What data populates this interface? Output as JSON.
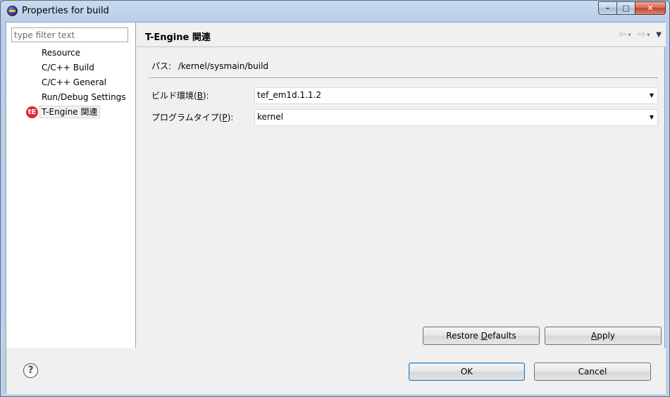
{
  "window": {
    "title": "Properties for build",
    "controls": {
      "minimize": "–",
      "maximize": "□",
      "close": "✕"
    }
  },
  "sidebar": {
    "filter_placeholder": "type filter text",
    "items": [
      {
        "label": "Resource"
      },
      {
        "label": "C/C++ Build"
      },
      {
        "label": "C/C++ General"
      },
      {
        "label": "Run/Debug Settings"
      },
      {
        "label": "T-Engine 関連",
        "icon": "t-engine-icon",
        "icon_text": "tE",
        "selected": true
      }
    ]
  },
  "page": {
    "title": "T-Engine 関連",
    "nav": {
      "back": "⇦",
      "forward": "⇨",
      "dropdown": "▾",
      "menu": "▼"
    },
    "path_label": "パス:",
    "path_value": "/kernel/sysmain/build",
    "build_env": {
      "label_prefix": "ビルド環境(",
      "mnemonic": "B",
      "label_suffix": "):",
      "value": "tef_em1d.1.1.2"
    },
    "program_type": {
      "label_prefix": "プログラムタイプ(",
      "mnemonic": "P",
      "label_suffix": "):",
      "value": "kernel"
    },
    "dropdown_arrow": "▼",
    "restore_defaults": {
      "prefix": "Restore ",
      "mnemonic": "D",
      "suffix": "efaults"
    },
    "apply": {
      "prefix": "",
      "mnemonic": "A",
      "suffix": "pply"
    }
  },
  "footer": {
    "help": "?",
    "ok": "OK",
    "cancel": "Cancel"
  }
}
